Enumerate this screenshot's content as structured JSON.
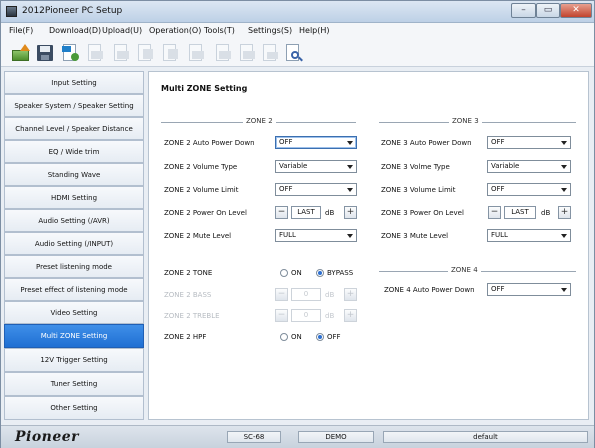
{
  "window": {
    "title": "2012Pioneer PC Setup"
  },
  "menu": [
    {
      "label": "File(F)"
    },
    {
      "label": "Download(D)"
    },
    {
      "label": "Upload(U)"
    },
    {
      "label": "Operation(O)"
    },
    {
      "label": "Tools(T)"
    },
    {
      "label": "Settings(S)"
    },
    {
      "label": "Help(H)"
    }
  ],
  "sidebar": {
    "items": [
      {
        "label": "Input Setting"
      },
      {
        "label": "Speaker System / Speaker Setting"
      },
      {
        "label": "Channel Level / Speaker Distance"
      },
      {
        "label": "EQ / Wide trim"
      },
      {
        "label": "Standing Wave"
      },
      {
        "label": "HDMI Setting"
      },
      {
        "label": "Audio Setting (/AVR)"
      },
      {
        "label": "Audio Setting (/INPUT)"
      },
      {
        "label": "Preset listening mode"
      },
      {
        "label": "Preset effect of listening mode"
      },
      {
        "label": "Video Setting"
      },
      {
        "label": "Multi ZONE Setting"
      },
      {
        "label": "12V Trigger Setting"
      },
      {
        "label": "Tuner Setting"
      },
      {
        "label": "Other Setting"
      }
    ],
    "active_index": 11
  },
  "panel": {
    "title": "Multi ZONE Setting",
    "zone2": {
      "group_label": "ZONE 2",
      "auto_power_down": {
        "label": "ZONE 2 Auto Power Down",
        "value": "OFF"
      },
      "volume_type": {
        "label": "ZONE 2 Volume Type",
        "value": "Variable"
      },
      "volume_limit": {
        "label": "ZONE 2 Volume Limit",
        "value": "OFF"
      },
      "power_on_level": {
        "label": "ZONE 2 Power On Level",
        "value": "LAST",
        "unit": "dB"
      },
      "mute_level": {
        "label": "ZONE 2 Mute Level",
        "value": "FULL"
      },
      "tone": {
        "label": "ZONE 2 TONE",
        "on_label": "ON",
        "bypass_label": "BYPASS",
        "selected": "BYPASS"
      },
      "bass": {
        "label": "ZONE 2 BASS",
        "value": "0",
        "unit": "dB"
      },
      "treble": {
        "label": "ZONE 2 TREBLE",
        "value": "0",
        "unit": "dB"
      },
      "hpf": {
        "label": "ZONE 2 HPF",
        "on_label": "ON",
        "off_label": "OFF",
        "selected": "OFF"
      }
    },
    "zone3": {
      "group_label": "ZONE 3",
      "auto_power_down": {
        "label": "ZONE 3 Auto Power Down",
        "value": "OFF"
      },
      "volume_type": {
        "label": "ZONE 3 Volme Type",
        "value": "Variable"
      },
      "volume_limit": {
        "label": "ZONE 3 Volume Limit",
        "value": "OFF"
      },
      "power_on_level": {
        "label": "ZONE 3 Power On Level",
        "value": "LAST",
        "unit": "dB"
      },
      "mute_level": {
        "label": "ZONE 3 Mute Level",
        "value": "FULL"
      }
    },
    "zone4": {
      "group_label": "ZONE 4",
      "auto_power_down": {
        "label": "ZONE 4 Auto Power Down",
        "value": "OFF"
      }
    }
  },
  "statusbar": {
    "logo": "Pioneer",
    "model": "SC-68",
    "mode": "DEMO",
    "preset": "default"
  },
  "colors": {
    "accent": "#2a7be0",
    "titlebar": "#c8d8ea",
    "close": "#c84a32"
  }
}
